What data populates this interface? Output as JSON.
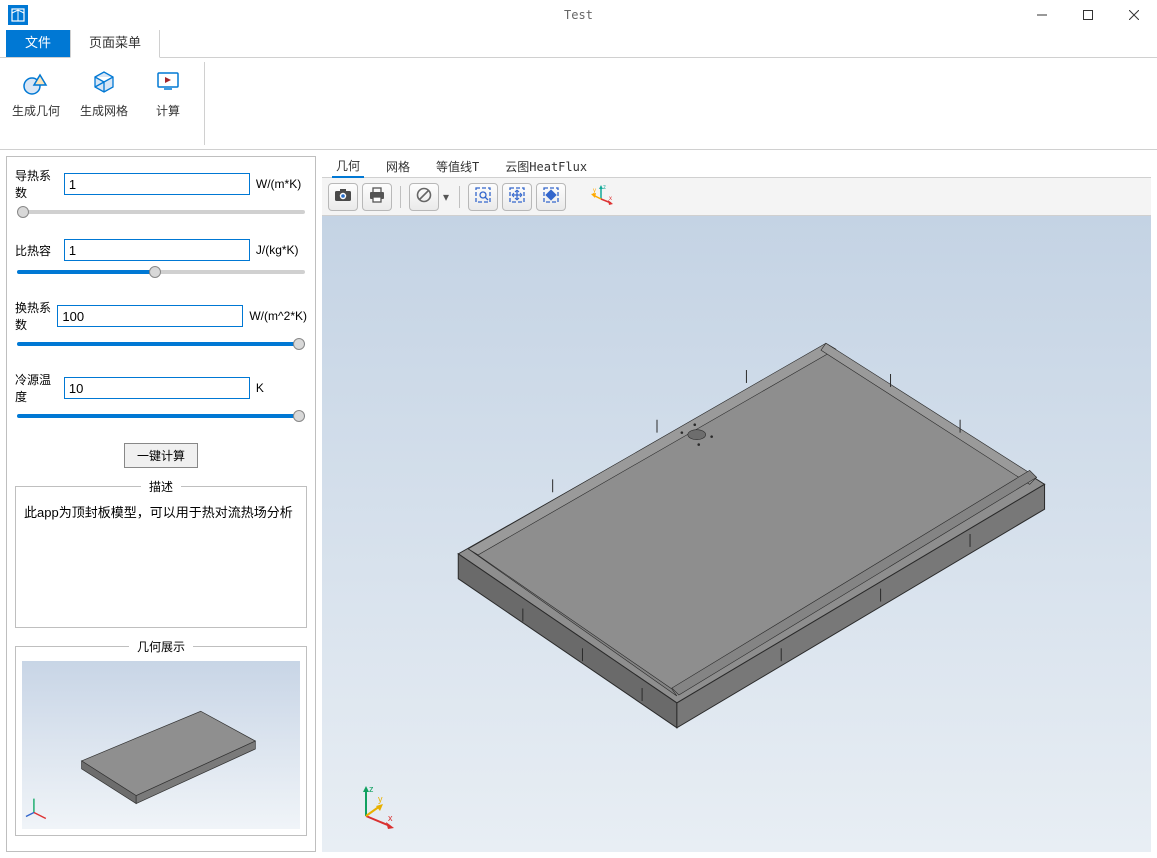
{
  "window": {
    "title": "Test"
  },
  "menu_tabs": {
    "file": "文件",
    "page": "页面菜单"
  },
  "ribbon": {
    "gen_geometry": "生成几何",
    "gen_mesh": "生成网格",
    "compute": "计算"
  },
  "params": {
    "thermal_cond": {
      "label": "导热系数",
      "value": "1",
      "unit": "W/(m*K)"
    },
    "spec_heat": {
      "label": "比热容",
      "value": "1",
      "unit": "J/(kg*K)"
    },
    "heat_transfer": {
      "label": "换热系数",
      "value": "100",
      "unit": "W/(m^2*K)"
    },
    "cold_temp": {
      "label": "冷源温度",
      "value": "10",
      "unit": "K"
    }
  },
  "compute_btn": "一键计算",
  "fieldsets": {
    "desc_title": "描述",
    "preview_title": "几何展示"
  },
  "description": "此app为顶封板模型，可以用于热对流热场分析",
  "view_tabs": {
    "geom": "几何",
    "mesh": "网格",
    "contour": "等值线T",
    "cloud": "云图HeatFlux"
  },
  "axes": {
    "x": "x",
    "y": "y",
    "z": "z"
  }
}
